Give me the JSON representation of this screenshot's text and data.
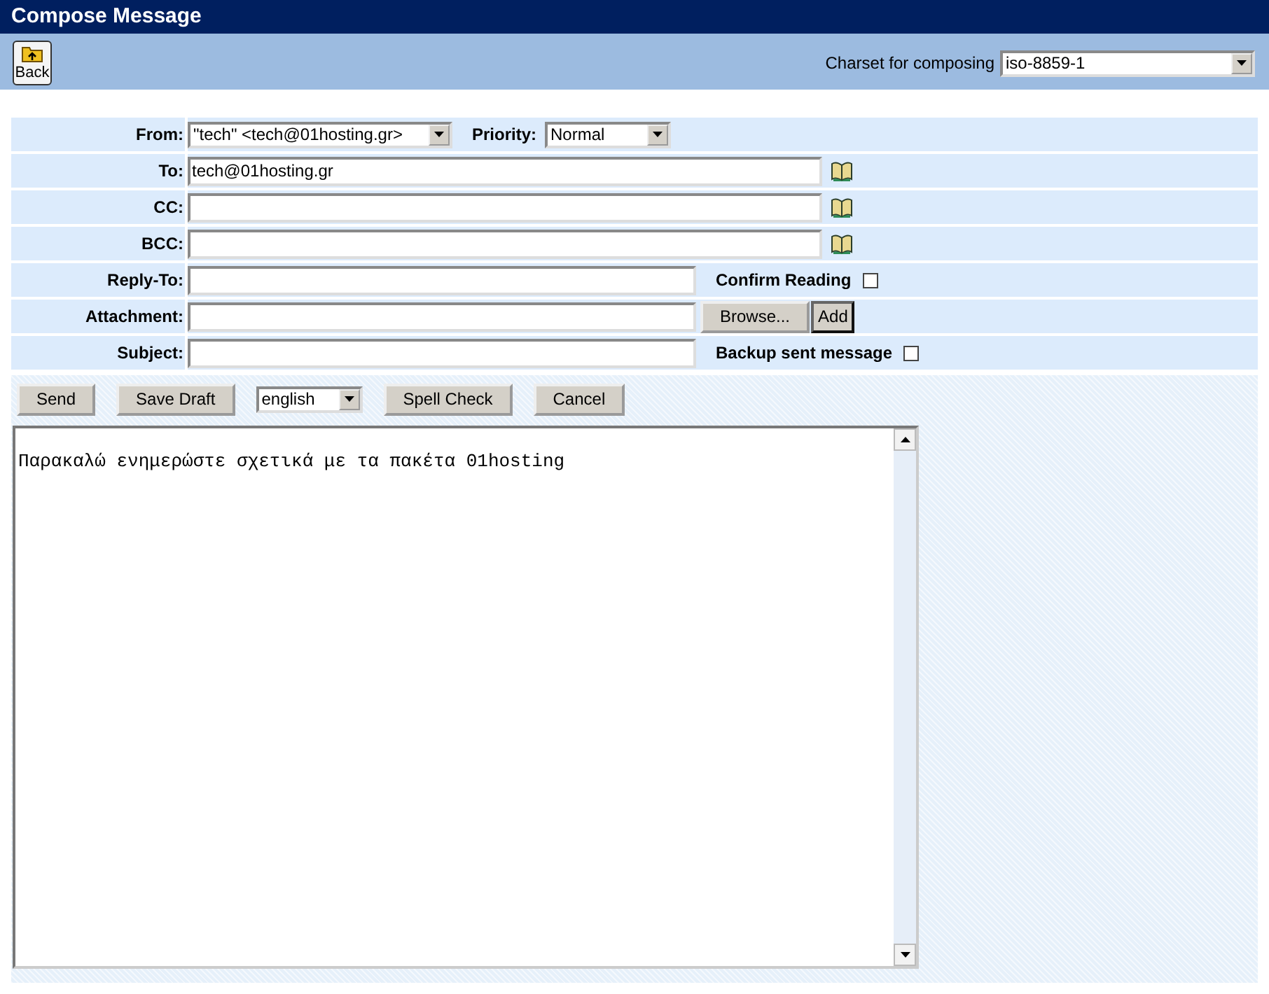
{
  "window": {
    "title": "Compose Message"
  },
  "toolbar": {
    "back_button": "Back",
    "charset_label": "Charset for composing",
    "charset_value": "iso-8859-1"
  },
  "form_rows": [
    {
      "kind": "from",
      "label": "From:",
      "value": "\"tech\" <tech@01hosting.gr>",
      "priority_label": "Priority:",
      "priority_value": "Normal"
    },
    {
      "kind": "address",
      "label": "To:",
      "value": "tech@01hosting.gr"
    },
    {
      "kind": "address",
      "label": "CC:"
    },
    {
      "kind": "address",
      "label": "BCC:"
    },
    {
      "kind": "option",
      "label": "Reply-To:",
      "option_label": "Confirm Reading",
      "checked": false
    },
    {
      "kind": "attachment",
      "label": "Attachment:",
      "browse_button": "Browse...",
      "add_button": "Add"
    },
    {
      "kind": "option",
      "label": "Subject:",
      "option_label": "Backup sent message",
      "checked": false
    }
  ],
  "actions": [
    {
      "kind": "button",
      "label": "Send"
    },
    {
      "kind": "button",
      "label": "Save Draft"
    },
    {
      "kind": "select",
      "label": "english"
    },
    {
      "kind": "button",
      "label": "Spell Check"
    },
    {
      "kind": "button",
      "label": "Cancel"
    }
  ],
  "message_body": "Παρακαλώ ενημερώστε σχετικά με τα πακέτα 01hosting"
}
